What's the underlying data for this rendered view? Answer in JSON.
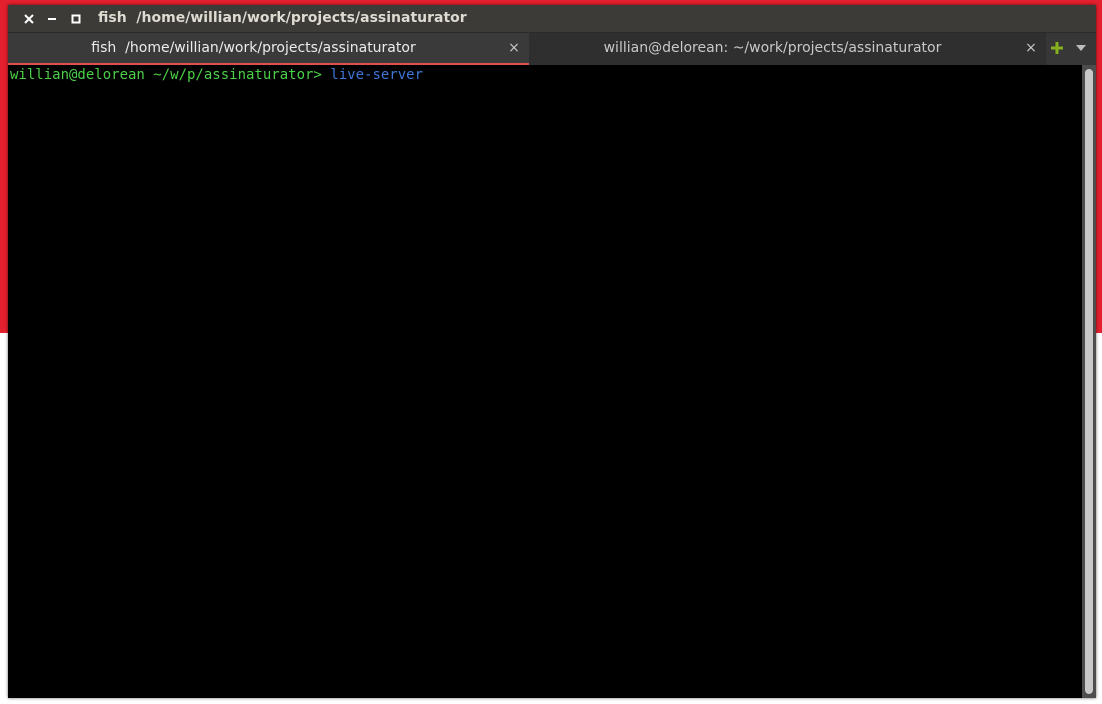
{
  "window": {
    "title": "fish  /home/willian/work/projects/assinaturator",
    "buttons": {
      "close_icon": "close-icon",
      "minimize_icon": "minimize-icon",
      "maximize_icon": "maximize-icon"
    }
  },
  "tabs": [
    {
      "label": "fish  /home/willian/work/projects/assinaturator",
      "close": "×",
      "active": true
    },
    {
      "label": "willian@delorean: ~/work/projects/assinaturator",
      "close": "×",
      "active": false
    }
  ],
  "tabbar": {
    "new_tab_icon": "plus-icon",
    "menu_icon": "chevron-down-icon",
    "accent_color": "#e0504f",
    "plus_color": "#87b11c"
  },
  "terminal": {
    "prompt": "willian@delorean ~/w/p/assinaturator> ",
    "command": "live-server",
    "prompt_color": "#4bd148",
    "command_color": "#4076d6"
  },
  "desktop": {
    "top_color": "#e3202e",
    "bottom_color": "#ffffff"
  }
}
